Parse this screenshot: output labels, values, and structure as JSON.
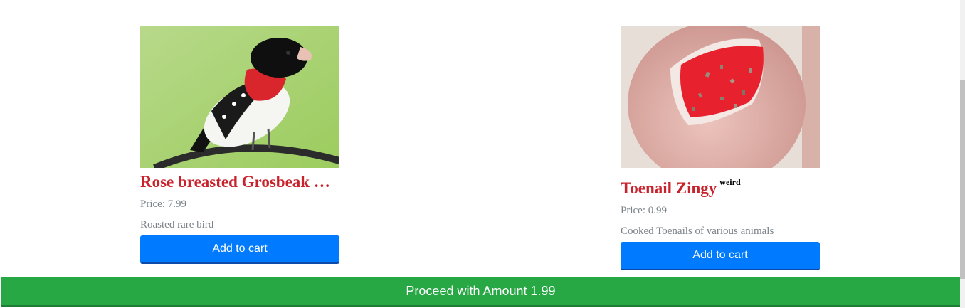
{
  "products": [
    {
      "title": "Rose breasted Grosbeak Roasted",
      "price": "Price: 7.99",
      "description": "Roasted rare bird",
      "button_label": "Add to cart"
    },
    {
      "title": "Toenail Zingy",
      "tag": "weird",
      "price": "Price: 0.99",
      "description": "Cooked Toenails of various animals",
      "button_label": "Add to cart"
    }
  ],
  "checkout": {
    "label": "Proceed with Amount 1.99"
  },
  "colors": {
    "title": "#c8232c",
    "primary": "#007bff",
    "success": "#28a745",
    "muted": "#7b838a"
  }
}
